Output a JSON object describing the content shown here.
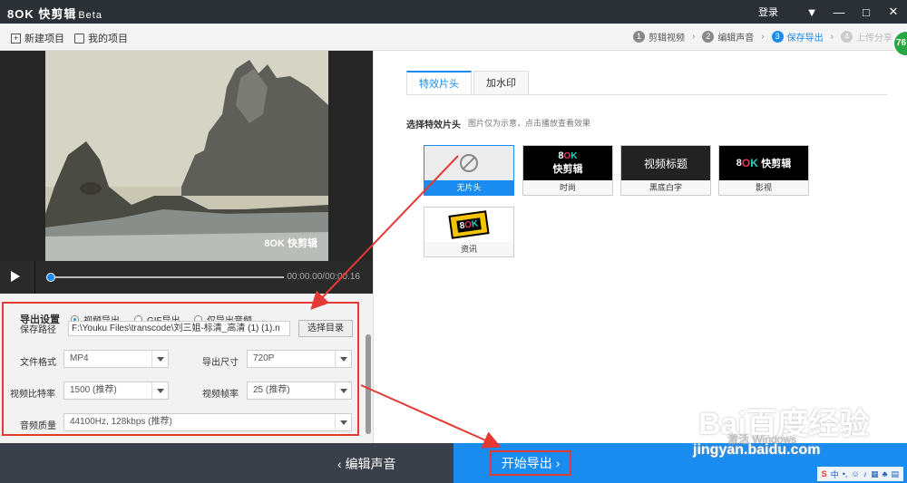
{
  "app": {
    "logo": "8OK 快剪辑",
    "beta": "Beta",
    "login": "登录"
  },
  "toolbar": {
    "new_project": "新建项目",
    "my_projects": "我的项目"
  },
  "steps": [
    {
      "num": "1",
      "label": "剪辑视频"
    },
    {
      "num": "2",
      "label": "编辑声音"
    },
    {
      "num": "3",
      "label": "保存导出"
    },
    {
      "num": "4",
      "label": "上传分享"
    }
  ],
  "badge": "76",
  "player": {
    "time": "00:00.00/00:00.16",
    "watermark": "8OK 快剪辑"
  },
  "export": {
    "title": "导出设置",
    "path_label": "保存路径",
    "modes": [
      "视频导出",
      "GIF导出",
      "仅导出音频"
    ],
    "path_value": "F:\\Youku Files\\transcode\\刘三姐-标清_高清 (1) (1).n",
    "choose_button": "选择目录",
    "format_label": "文件格式",
    "format_value": "MP4",
    "size_label": "导出尺寸",
    "size_value": "720P",
    "bitrate_label": "视频比特率",
    "bitrate_value": "1500 (推荐)",
    "fps_label": "视频帧率",
    "fps_value": "25 (推荐)",
    "audio_label": "音频质量",
    "audio_value": "44100Hz, 128kbps (推荐)"
  },
  "right": {
    "tabs": [
      "特效片头",
      "加水印"
    ],
    "section_title": "选择特效片头",
    "hint": "图片仅为示意，点击播放查看效果",
    "cards": [
      {
        "caption": "无片头"
      },
      {
        "caption": "时尚",
        "thumb": "快剪辑"
      },
      {
        "caption": "黑底白字",
        "thumb": "视频标题"
      },
      {
        "caption": "影视",
        "thumb": "快剪辑"
      },
      {
        "caption": "资讯"
      }
    ]
  },
  "bottom": {
    "back": "编辑声音",
    "export": "开始导出"
  },
  "ime": "中",
  "watermark_site": {
    "brand": "Bai百度经验",
    "url": "jingyan.baidu.com",
    "windows": "激活 Windows"
  },
  "colors": {
    "accent": "#1a8cf0",
    "highlight": "#e53935",
    "titlebar": "#2b3036"
  }
}
